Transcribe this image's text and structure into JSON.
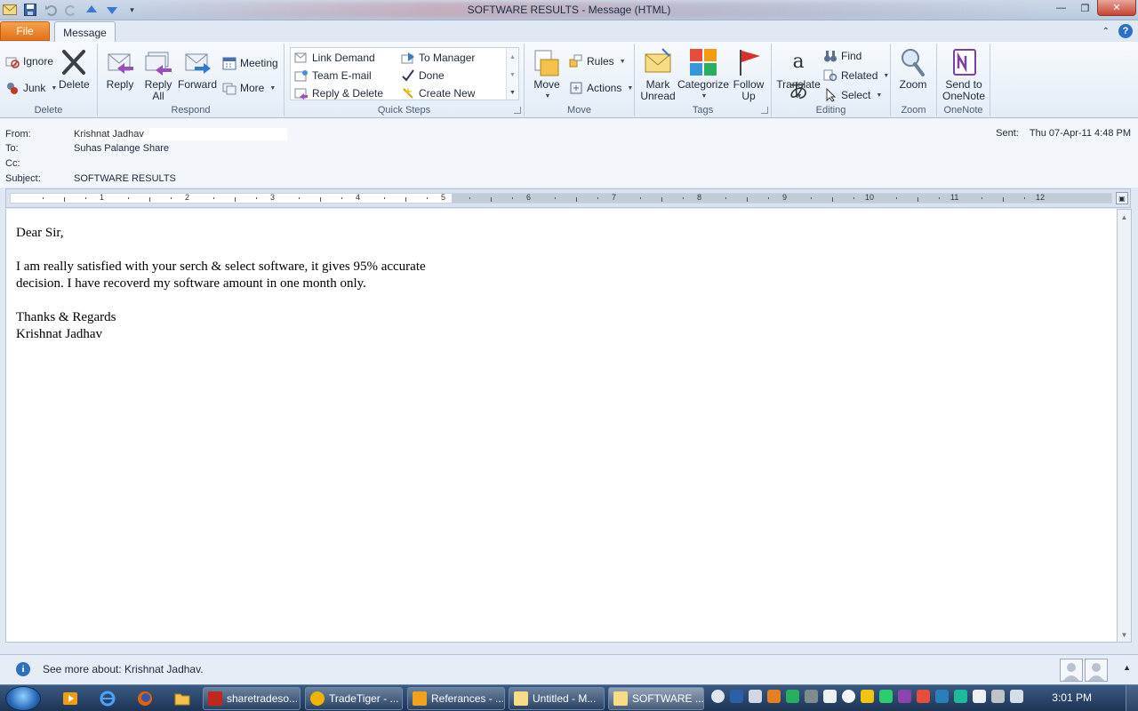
{
  "window": {
    "title": "SOFTWARE RESULTS  -  Message (HTML)"
  },
  "tabs": {
    "file": "File",
    "message": "Message"
  },
  "ribbon": {
    "delete": {
      "label": "Delete",
      "ignore": "Ignore",
      "junk": "Junk",
      "delete": "Delete"
    },
    "respond": {
      "label": "Respond",
      "reply": "Reply",
      "reply_all": "Reply All",
      "forward": "Forward",
      "meeting": "Meeting",
      "more": "More"
    },
    "quick_steps": {
      "label": "Quick Steps",
      "items": [
        "Link Demand",
        "To Manager",
        "Team E-mail",
        "Done",
        "Reply & Delete",
        "Create New"
      ]
    },
    "move": {
      "label": "Move",
      "move": "Move",
      "rules": "Rules",
      "actions": "Actions"
    },
    "tags": {
      "label": "Tags",
      "mark_unread": "Mark Unread",
      "categorize": "Categorize",
      "follow_up": "Follow Up"
    },
    "editing": {
      "label": "Editing",
      "translate": "Translate",
      "find": "Find",
      "related": "Related",
      "select": "Select"
    },
    "zoom": {
      "label": "Zoom",
      "zoom": "Zoom"
    },
    "onenote": {
      "label": "OneNote",
      "send": "Send to OneNote"
    }
  },
  "header": {
    "from_label": "From:",
    "from": "Krishnat Jadhav",
    "to_label": "To:",
    "to": "Suhas Palange Share",
    "cc_label": "Cc:",
    "cc": "",
    "subject_label": "Subject:",
    "subject": "SOFTWARE RESULTS",
    "sent_label": "Sent:",
    "sent": "Thu 07-Apr-11 4:48 PM"
  },
  "ruler": {
    "numbers": [
      "1",
      "2",
      "3",
      "4",
      "5",
      "6",
      "7",
      "8",
      "9",
      "10",
      "11",
      "12"
    ]
  },
  "body": {
    "greeting": "Dear Sir,",
    "line1": "I am really satisfied with your serch & select software, it gives 95% accurate",
    "line2": "decision. I have recoverd my software amount in one month only.",
    "closing": "Thanks & Regards",
    "signature": "Krishnat Jadhav"
  },
  "people_pane": {
    "text": "See more about: Krishnat Jadhav."
  },
  "taskbar": {
    "tasks": [
      "sharetradeso...",
      "TradeTiger - ...",
      "Referances - ...",
      "Untitled - M...",
      "SOFTWARE ..."
    ],
    "clock": "3:01 PM"
  },
  "colors": {
    "file_tab": "#e2711a",
    "accent": "#2c6fc8",
    "close_button": "#c5452f"
  }
}
